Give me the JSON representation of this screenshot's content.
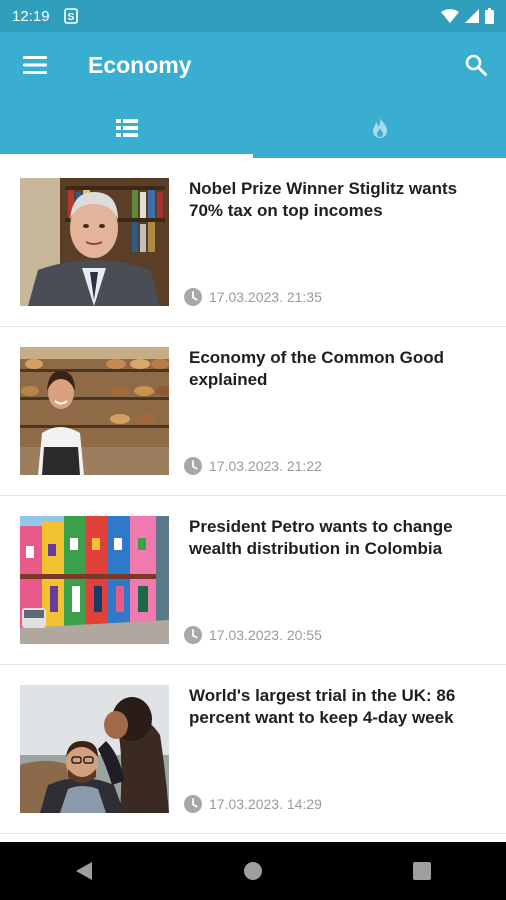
{
  "status_bar": {
    "time": "12:19",
    "icons": [
      "storage-s-icon",
      "wifi-icon",
      "signal-icon",
      "battery-icon"
    ]
  },
  "app_bar": {
    "title": "Economy",
    "icons": [
      "menu-icon",
      "search-icon"
    ],
    "color": "#3aaed0"
  },
  "tabs": [
    {
      "icon": "list-icon",
      "active": true
    },
    {
      "icon": "flame-icon",
      "active": false
    }
  ],
  "articles": [
    {
      "title": "Nobel Prize Winner Stiglitz wants 70% tax on top incomes",
      "timestamp": "17.03.2023. 21:35"
    },
    {
      "title": "Economy of the Common Good explained",
      "timestamp": "17.03.2023. 21:22"
    },
    {
      "title": "President Petro wants to change wealth distribution in Colombia",
      "timestamp": "17.03.2023. 20:55"
    },
    {
      "title": "World's largest trial in the UK: 86 percent want to keep 4-day week",
      "timestamp": "17.03.2023. 14:29"
    }
  ],
  "nav_bar": {
    "icons": [
      "back-icon",
      "home-icon",
      "recents-icon"
    ]
  }
}
